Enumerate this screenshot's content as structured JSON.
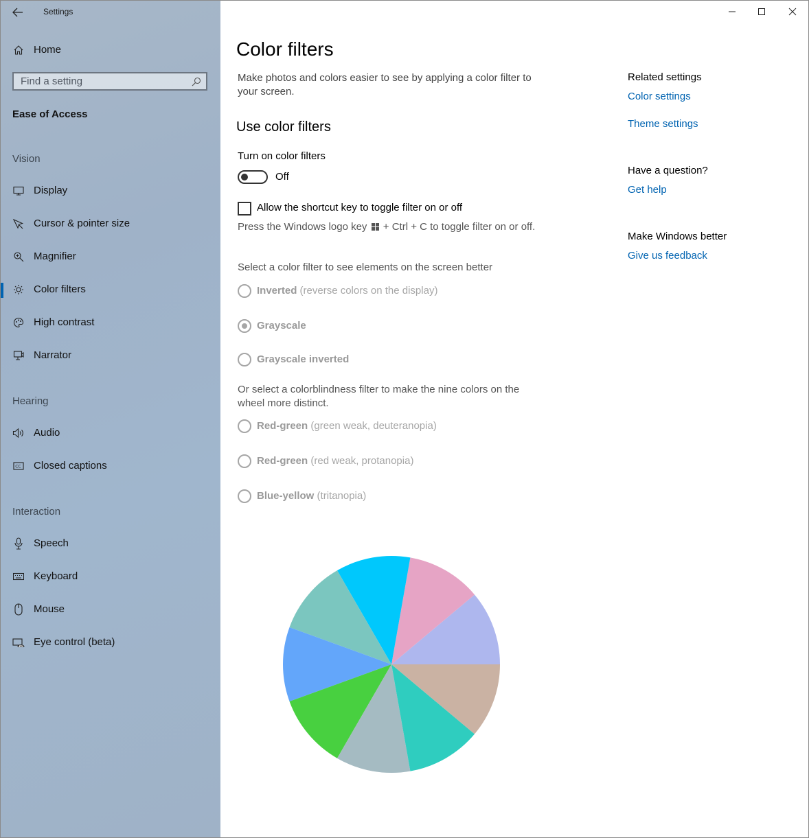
{
  "window": {
    "app_title": "Settings"
  },
  "sidebar": {
    "home_label": "Home",
    "search_placeholder": "Find a setting",
    "group_title": "Ease of Access",
    "sections": {
      "vision": "Vision",
      "hearing": "Hearing",
      "interaction": "Interaction"
    },
    "items": [
      {
        "label": "Display",
        "icon": "monitor-icon"
      },
      {
        "label": "Cursor & pointer size",
        "icon": "cursor-icon"
      },
      {
        "label": "Magnifier",
        "icon": "magnifier-icon"
      },
      {
        "label": "Color filters",
        "icon": "sun-icon",
        "selected": true
      },
      {
        "label": "High contrast",
        "icon": "palette-icon"
      },
      {
        "label": "Narrator",
        "icon": "narrator-icon"
      },
      {
        "label": "Audio",
        "icon": "speaker-icon"
      },
      {
        "label": "Closed captions",
        "icon": "captions-icon"
      },
      {
        "label": "Speech",
        "icon": "microphone-icon"
      },
      {
        "label": "Keyboard",
        "icon": "keyboard-icon"
      },
      {
        "label": "Mouse",
        "icon": "mouse-icon"
      },
      {
        "label": "Eye control (beta)",
        "icon": "eye-icon"
      }
    ],
    "accent_color": "#0063b1"
  },
  "main": {
    "title": "Color filters",
    "description": "Make photos and colors easier to see by applying a color filter to your screen.",
    "section_title": "Use color filters",
    "toggle_label": "Turn on color filters",
    "toggle_state": "Off",
    "shortcut_label": "Allow the shortcut key to toggle filter on or off",
    "shortcut_hint_before": "Press the Windows logo key",
    "shortcut_hint_after": "+ Ctrl + C to toggle filter on or off.",
    "filter_prompt": "Select a color filter to see elements on the screen better",
    "filters": [
      {
        "name": "Inverted",
        "detail": "(reverse colors on the display)",
        "checked": false
      },
      {
        "name": "Grayscale",
        "detail": "",
        "checked": true
      },
      {
        "name": "Grayscale inverted",
        "detail": "",
        "checked": false
      }
    ],
    "colorblind_prompt": "Or select a colorblindness filter to make the nine colors on the wheel more distinct.",
    "colorblind_filters": [
      {
        "name": "Red-green",
        "detail": "(green weak, deuteranopia)",
        "checked": false
      },
      {
        "name": "Red-green",
        "detail": "(red weak, protanopia)",
        "checked": false
      },
      {
        "name": "Blue-yellow",
        "detail": "(tritanopia)",
        "checked": false
      }
    ],
    "color_wheel": [
      "#aeb7ee",
      "#e6a4c5",
      "#00c8fc",
      "#7bc6bf",
      "#63a6fa",
      "#48d040",
      "#a5bbc2",
      "#2fcdbf",
      "#cab2a3"
    ]
  },
  "related": {
    "related_heading": "Related settings",
    "color_settings": "Color settings",
    "theme_settings": "Theme settings",
    "question_heading": "Have a question?",
    "get_help": "Get help",
    "feedback_heading": "Make Windows better",
    "give_feedback": "Give us feedback"
  }
}
